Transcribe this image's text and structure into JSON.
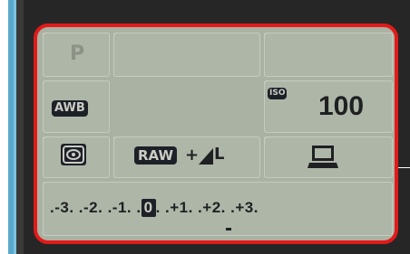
{
  "quick_control": {
    "shooting_mode": "P",
    "white_balance": "AWB",
    "iso_label": "ISO",
    "iso_value": "100",
    "metering_icon": "evaluative-metering-icon",
    "image_quality": {
      "raw": "RAW",
      "plus": "+",
      "size_icon": "large-size-icon",
      "size_letter": "L"
    },
    "destination_icon": "computer-icon",
    "exposure_scale": ".-3. .-2. .-1. .",
    "exposure_zero": "0",
    "exposure_scale_right": ". .+1. .+2. .+3.",
    "accent": "#e21a1a"
  }
}
